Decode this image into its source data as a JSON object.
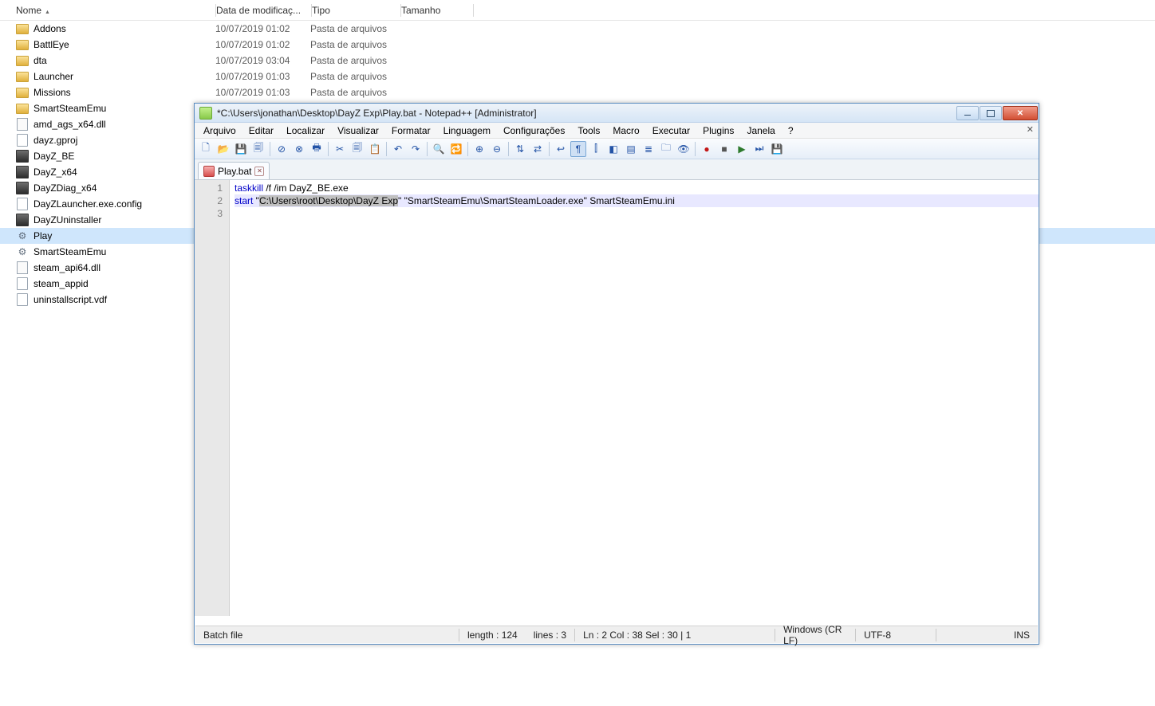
{
  "explorer": {
    "columns": {
      "nome": "Nome",
      "data": "Data de modificaç...",
      "tipo": "Tipo",
      "tam": "Tamanho"
    },
    "rows": [
      {
        "icon": "folder",
        "name": "Addons",
        "date": "10/07/2019 01:02",
        "type": "Pasta de arquivos"
      },
      {
        "icon": "folder",
        "name": "BattlEye",
        "date": "10/07/2019 01:02",
        "type": "Pasta de arquivos"
      },
      {
        "icon": "folder",
        "name": "dta",
        "date": "10/07/2019 03:04",
        "type": "Pasta de arquivos"
      },
      {
        "icon": "folder",
        "name": "Launcher",
        "date": "10/07/2019 01:03",
        "type": "Pasta de arquivos"
      },
      {
        "icon": "folder",
        "name": "Missions",
        "date": "10/07/2019 01:03",
        "type": "Pasta de arquivos"
      },
      {
        "icon": "folder",
        "name": "SmartSteamEmu",
        "date": "",
        "type": ""
      },
      {
        "icon": "dll",
        "name": "amd_ags_x64.dll",
        "date": "",
        "type": ""
      },
      {
        "icon": "file",
        "name": "dayz.gproj",
        "date": "",
        "type": ""
      },
      {
        "icon": "exe",
        "name": "DayZ_BE",
        "date": "",
        "type": ""
      },
      {
        "icon": "exe",
        "name": "DayZ_x64",
        "date": "",
        "type": ""
      },
      {
        "icon": "exe",
        "name": "DayZDiag_x64",
        "date": "",
        "type": ""
      },
      {
        "icon": "file",
        "name": "DayZLauncher.exe.config",
        "date": "",
        "type": ""
      },
      {
        "icon": "exe",
        "name": "DayZUninstaller",
        "date": "",
        "type": ""
      },
      {
        "icon": "bat",
        "name": "Play",
        "date": "",
        "type": "",
        "selected": true
      },
      {
        "icon": "gear",
        "name": "SmartSteamEmu",
        "date": "",
        "type": ""
      },
      {
        "icon": "dll",
        "name": "steam_api64.dll",
        "date": "",
        "type": ""
      },
      {
        "icon": "file",
        "name": "steam_appid",
        "date": "",
        "type": ""
      },
      {
        "icon": "file",
        "name": "uninstallscript.vdf",
        "date": "",
        "type": ""
      }
    ]
  },
  "npp": {
    "title": "*C:\\Users\\jonathan\\Desktop\\DayZ Exp\\Play.bat - Notepad++ [Administrator]",
    "menus": [
      "Arquivo",
      "Editar",
      "Localizar",
      "Visualizar",
      "Formatar",
      "Linguagem",
      "Configurações",
      "Tools",
      "Macro",
      "Executar",
      "Plugins",
      "Janela",
      "?"
    ],
    "tab": "Play.bat",
    "code": {
      "line1_kw": "taskkill",
      "line1_rest": " /f /im DayZ_BE.exe",
      "line2_kw": "start",
      "line2_a": " \"",
      "line2_sel": "C:\\Users\\root\\Desktop\\DayZ Exp",
      "line2_b": "\" \"SmartSteamEmu\\SmartSteamLoader.exe\" SmartSteamEmu.ini"
    },
    "status": {
      "lang": "Batch file",
      "length": "length : 124",
      "lines": "lines : 3",
      "pos": "Ln : 2    Col : 38    Sel : 30 | 1",
      "eol": "Windows (CR LF)",
      "enc": "UTF-8",
      "ins": "INS"
    }
  }
}
